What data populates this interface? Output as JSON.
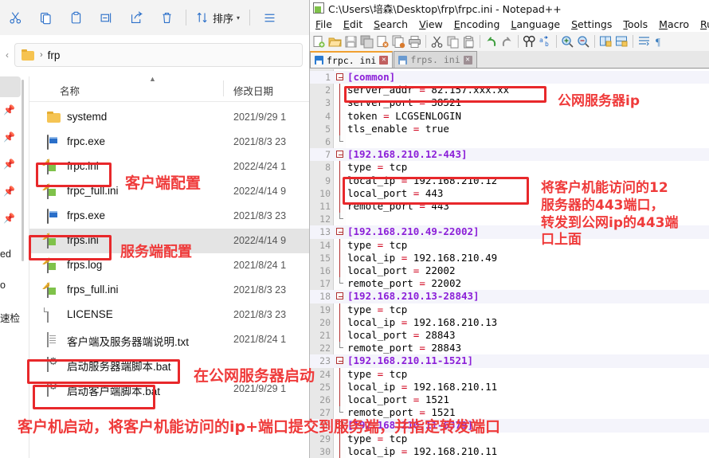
{
  "explorer": {
    "toolbar": {
      "icons": [
        {
          "name": "cut-icon",
          "glyph": "✂"
        },
        {
          "name": "copy-icon",
          "glyph": "❐"
        },
        {
          "name": "paste-icon",
          "glyph": "ὌB"
        },
        {
          "name": "rename-icon",
          "glyph": "✎"
        },
        {
          "name": "share-icon",
          "glyph": "↪"
        },
        {
          "name": "delete-icon",
          "glyph": "Ὕ1"
        }
      ],
      "sort_label": "排序",
      "sort_chevron": "▾",
      "view_menu_glyph": "☰"
    },
    "address": {
      "path_segment": "frp",
      "separator": "›"
    },
    "nav_fragments": [
      "ed",
      "o",
      "速检"
    ],
    "columns": {
      "name": "名称",
      "date_modified": "修改日期"
    },
    "files": [
      {
        "name": "systemd",
        "date": "2021/9/29 1",
        "icon": "folder-icon",
        "selected": false
      },
      {
        "name": "frpc.exe",
        "date": "2021/8/3 23",
        "icon": "exe-icon",
        "selected": false
      },
      {
        "name": "frpc.ini",
        "date": "2022/4/24 1",
        "icon": "ini-file-icon",
        "selected": false
      },
      {
        "name": "frpc_full.ini",
        "date": "2022/4/14 9",
        "icon": "ini-file-icon",
        "selected": false
      },
      {
        "name": "frps.exe",
        "date": "2021/8/3 23",
        "icon": "exe-icon",
        "selected": false
      },
      {
        "name": "frps.ini",
        "date": "2022/4/14 9",
        "icon": "ini-file-icon",
        "selected": true
      },
      {
        "name": "frps.log",
        "date": "2021/8/24 1",
        "icon": "ini-file-icon",
        "selected": false
      },
      {
        "name": "frps_full.ini",
        "date": "2021/8/3 23",
        "icon": "ini-file-icon",
        "selected": false
      },
      {
        "name": "LICENSE",
        "date": "2021/8/3 23",
        "icon": "plain-file-icon",
        "selected": false
      },
      {
        "name": "客户端及服务器端说明.txt",
        "date": "2021/8/24 1",
        "icon": "text-file-icon",
        "selected": false
      },
      {
        "name": "启动服务器端脚本.bat",
        "date": "",
        "icon": "bat-file-icon",
        "selected": false
      },
      {
        "name": "启动客户端脚本.bat",
        "date": "2021/9/29 1",
        "icon": "bat-file-icon",
        "selected": false
      }
    ]
  },
  "notepadpp": {
    "title": "C:\\Users\\培森\\Desktop\\frp\\frpc.ini - Notepad++",
    "menu": [
      "File",
      "Edit",
      "Search",
      "View",
      "Encoding",
      "Language",
      "Settings",
      "Tools",
      "Macro",
      "Run"
    ],
    "toolbar_icons": [
      "new-file-icon",
      "open-file-icon",
      "save-icon",
      "save-all-icon",
      "close-file-icon",
      "close-all-icon",
      "print-icon",
      "cut-icon",
      "copy-icon",
      "paste-icon",
      "undo-icon",
      "redo-icon",
      "find-icon",
      "replace-icon",
      "zoom-in-icon",
      "zoom-out-icon",
      "sync-v-icon",
      "sync-h-icon",
      "word-wrap-icon",
      "show-all-chars-icon"
    ],
    "tabs": [
      {
        "label": "frpc. ini",
        "active": true
      },
      {
        "label": "frps. ini",
        "active": false
      }
    ],
    "lines": [
      {
        "n": 1,
        "section": true,
        "fold": "start",
        "text": "[common]"
      },
      {
        "n": 2,
        "section": false,
        "fold": "mid",
        "text": "server_addr = 82.157.xxx.xx"
      },
      {
        "n": 3,
        "section": false,
        "fold": "mid",
        "text": "server_port = 38521"
      },
      {
        "n": 4,
        "section": false,
        "fold": "mid",
        "text": "token = LCGSENLOGIN"
      },
      {
        "n": 5,
        "section": false,
        "fold": "mid",
        "text": "tls_enable = true"
      },
      {
        "n": 6,
        "section": false,
        "fold": "end",
        "text": ""
      },
      {
        "n": 7,
        "section": true,
        "fold": "start",
        "text": "[192.168.210.12-443]"
      },
      {
        "n": 8,
        "section": false,
        "fold": "mid",
        "text": "type = tcp"
      },
      {
        "n": 9,
        "section": false,
        "fold": "mid",
        "text": "local_ip = 192.168.210.12"
      },
      {
        "n": 10,
        "section": false,
        "fold": "mid",
        "text": "local_port = 443"
      },
      {
        "n": 11,
        "section": false,
        "fold": "mid",
        "text": "remote_port = 443"
      },
      {
        "n": 12,
        "section": false,
        "fold": "end",
        "text": ""
      },
      {
        "n": 13,
        "section": true,
        "fold": "start",
        "text": "[192.168.210.49-22002]"
      },
      {
        "n": 14,
        "section": false,
        "fold": "mid",
        "text": "type = tcp"
      },
      {
        "n": 15,
        "section": false,
        "fold": "mid",
        "text": "local_ip = 192.168.210.49"
      },
      {
        "n": 16,
        "section": false,
        "fold": "mid",
        "text": "local_port = 22002"
      },
      {
        "n": 17,
        "section": false,
        "fold": "end",
        "text": "remote_port = 22002"
      },
      {
        "n": 18,
        "section": true,
        "fold": "start",
        "text": "[192.168.210.13-28843]"
      },
      {
        "n": 19,
        "section": false,
        "fold": "mid",
        "text": "type = tcp"
      },
      {
        "n": 20,
        "section": false,
        "fold": "mid",
        "text": "local_ip = 192.168.210.13"
      },
      {
        "n": 21,
        "section": false,
        "fold": "mid",
        "text": "local_port = 28843"
      },
      {
        "n": 22,
        "section": false,
        "fold": "end",
        "text": "remote_port = 28843"
      },
      {
        "n": 23,
        "section": true,
        "fold": "start",
        "text": "[192.168.210.11-1521]"
      },
      {
        "n": 24,
        "section": false,
        "fold": "mid",
        "text": "type = tcp"
      },
      {
        "n": 25,
        "section": false,
        "fold": "mid",
        "text": "local_ip = 192.168.210.11"
      },
      {
        "n": 26,
        "section": false,
        "fold": "mid",
        "text": "local_port = 1521"
      },
      {
        "n": 27,
        "section": false,
        "fold": "end",
        "text": "remote_port = 1521"
      },
      {
        "n": 28,
        "section": true,
        "fold": "start",
        "text": "[192.168.210.11-6379]"
      },
      {
        "n": 29,
        "section": false,
        "fold": "mid",
        "text": "type = tcp"
      },
      {
        "n": 30,
        "section": false,
        "fold": "mid",
        "text": "local_ip = 192.168.210.11"
      }
    ]
  },
  "annotations": {
    "color": "#ef3b3b",
    "box_color": "#e8282b",
    "texts": {
      "client_config": "客户端配置",
      "server_config": "服务端配置",
      "start_on_public_server": "在公网服务器启动",
      "public_server_ip": "公网服务器ip",
      "forward_rule": "将客户机能访问的12\n服务器的443端口，\n转发到公网ip的443端\n口上面",
      "bottom_note": "客户机启动，将客户机能访问的ip+端口提交到服务端，并指定转发端口"
    }
  }
}
